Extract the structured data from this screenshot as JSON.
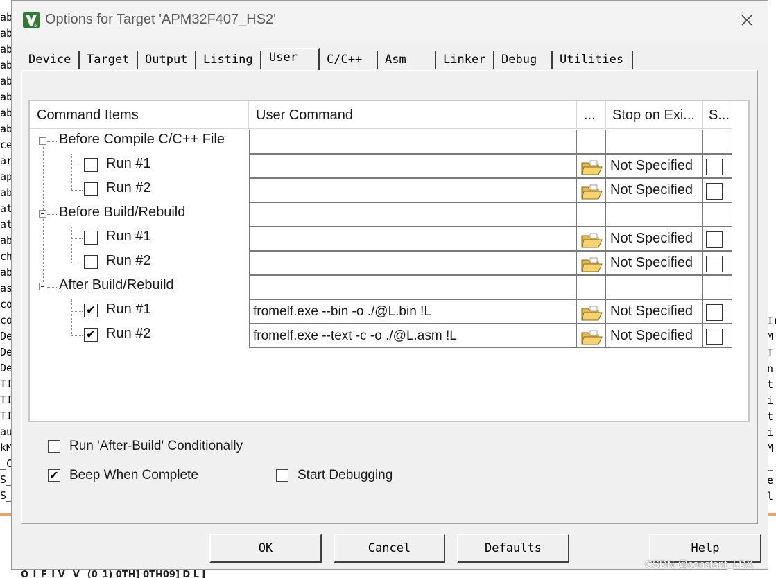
{
  "window": {
    "title": "Options for Target 'APM32F407_HS2'"
  },
  "tabs": [
    {
      "label": "Device"
    },
    {
      "label": "Target"
    },
    {
      "label": "Output"
    },
    {
      "label": "Listing"
    },
    {
      "label": "User"
    },
    {
      "label": "C/C++"
    },
    {
      "label": "Asm"
    },
    {
      "label": "Linker"
    },
    {
      "label": "Debug"
    },
    {
      "label": "Utilities"
    }
  ],
  "active_tab": "User",
  "grid": {
    "headers": [
      "Command Items",
      "User Command",
      "...",
      "Stop on Exi...",
      "S..."
    ],
    "groups": [
      {
        "label": "Before Compile C/C++ File",
        "runs": [
          {
            "label": "Run #1",
            "checked": false,
            "command": "",
            "stop": "Not Specified"
          },
          {
            "label": "Run #2",
            "checked": false,
            "command": "",
            "stop": "Not Specified"
          }
        ]
      },
      {
        "label": "Before Build/Rebuild",
        "runs": [
          {
            "label": "Run #1",
            "checked": false,
            "command": "",
            "stop": "Not Specified"
          },
          {
            "label": "Run #2",
            "checked": false,
            "command": "",
            "stop": "Not Specified"
          }
        ]
      },
      {
        "label": "After Build/Rebuild",
        "runs": [
          {
            "label": "Run #1",
            "checked": true,
            "command": "fromelf.exe --bin -o ./@L.bin !L",
            "stop": "Not Specified"
          },
          {
            "label": "Run #2",
            "checked": true,
            "command": "fromelf.exe --text -c -o ./@L.asm !L",
            "stop": "Not Specified"
          }
        ]
      }
    ]
  },
  "options": {
    "run_after_build_conditionally": {
      "label": "Run 'After-Build' Conditionally",
      "checked": false
    },
    "beep_when_complete": {
      "label": "Beep When Complete",
      "checked": true
    },
    "start_debugging": {
      "label": "Start Debugging",
      "checked": false
    }
  },
  "buttons": {
    "ok": "OK",
    "cancel": "Cancel",
    "defaults": "Defaults",
    "help": "Help"
  },
  "watermark": "CSDN @constant_LDX",
  "background": {
    "left_fragments": [
      "ab",
      "ab",
      "ab",
      "ab",
      "ab",
      "ab",
      "ab",
      "ab",
      "ce",
      "ar",
      "ap",
      "ab",
      "at",
      "at",
      "ab",
      "ch",
      "ab",
      "as",
      "co",
      "co",
      "De",
      "De",
      "De",
      "TI",
      "TI",
      "TI",
      "au",
      "kM",
      "_C",
      "S_",
      "S_"
    ],
    "right_fragments": [
      "Ir",
      "M",
      "T",
      "n",
      "t",
      "i",
      "t",
      "i",
      "M",
      "_",
      "e",
      "l"
    ],
    "bottom_text": "O_I_F_I V_ V_ (0_1) 0TH] 0TH09] D L J"
  },
  "icons": {
    "app": "keil-uvision-icon",
    "close": "close-icon",
    "folder": "folder-open-icon"
  }
}
